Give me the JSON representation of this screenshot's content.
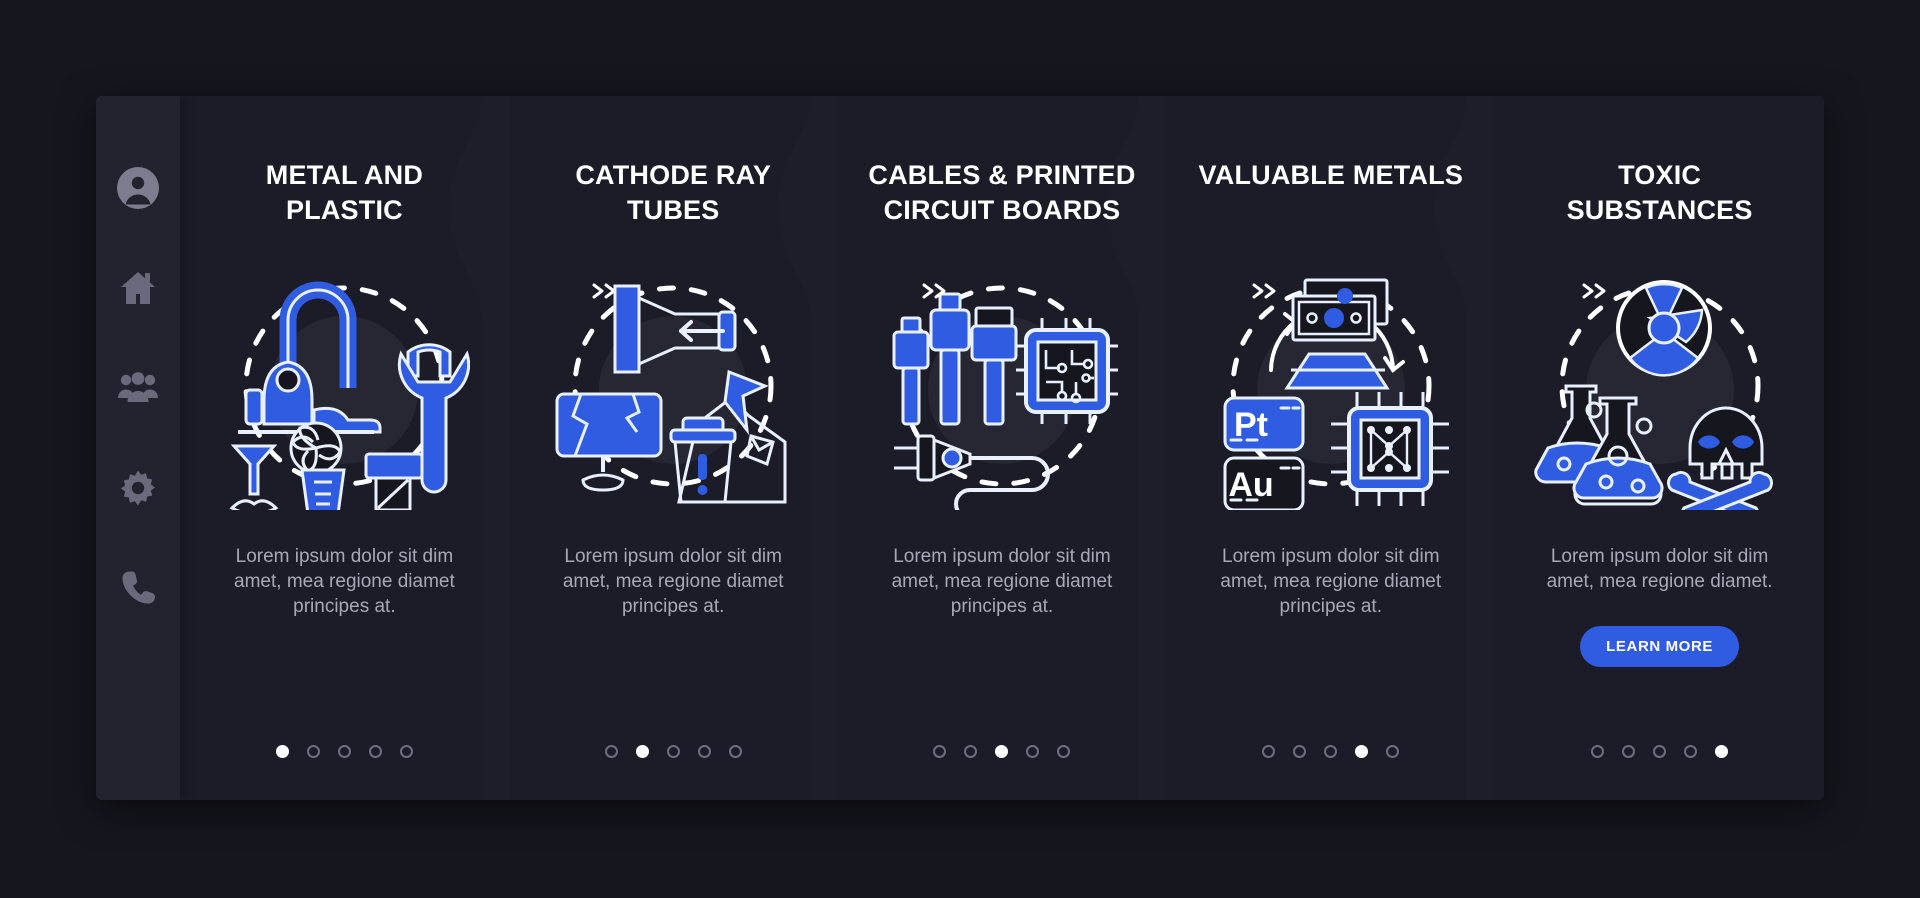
{
  "app": {
    "background_color": "#16161f",
    "panel_color": "#1e1e2a",
    "sidebar_color": "#23222f",
    "accent_color": "#2f5ce0",
    "title_color": "#ffffff",
    "body_color": "#a9a8b6"
  },
  "sidebar": {
    "items": [
      {
        "icon": "avatar-icon",
        "name": "sidebar-item-profile"
      },
      {
        "icon": "home-icon",
        "name": "sidebar-item-home"
      },
      {
        "icon": "people-icon",
        "name": "sidebar-item-people"
      },
      {
        "icon": "gear-icon",
        "name": "sidebar-item-settings"
      },
      {
        "icon": "phone-icon",
        "name": "sidebar-item-contact"
      }
    ]
  },
  "separator": {
    "glyph": "»",
    "label": "next-step-chevron"
  },
  "steps": [
    {
      "title": "METAL AND PLASTIC",
      "body": "Lorem ipsum dolor sit dim amet, mea regione diamet principes at.",
      "illustration": "vacuum-wrench-tools-icon",
      "active_dot": 0,
      "dot_count": 5,
      "cta": null
    },
    {
      "title": "CATHODE RAY TUBES",
      "body": "Lorem ipsum dolor sit dim amet, mea regione diamet principes at.",
      "illustration": "crt-monitor-waste-icon",
      "active_dot": 1,
      "dot_count": 5,
      "cta": null
    },
    {
      "title": "CABLES & PRINTED CIRCUIT BOARDS",
      "body": "Lorem ipsum dolor sit dim amet, mea regione diamet principes at.",
      "illustration": "cables-chip-plug-icon",
      "active_dot": 2,
      "dot_count": 5,
      "cta": null
    },
    {
      "title": "VALUABLE METALS",
      "body": "Lorem ipsum dolor sit dim amet, mea regione diamet principes at.",
      "illustration": "money-gold-elements-chip-icon",
      "active_dot": 3,
      "dot_count": 5,
      "cta": null,
      "element_labels": [
        "Pt",
        "Au"
      ]
    },
    {
      "title": "TOXIC SUBSTANCES",
      "body": "Lorem ipsum dolor sit dim amet, mea regione diamet.",
      "illustration": "radiation-flasks-skull-icon",
      "active_dot": 4,
      "dot_count": 5,
      "cta": "LEARN MORE"
    }
  ]
}
